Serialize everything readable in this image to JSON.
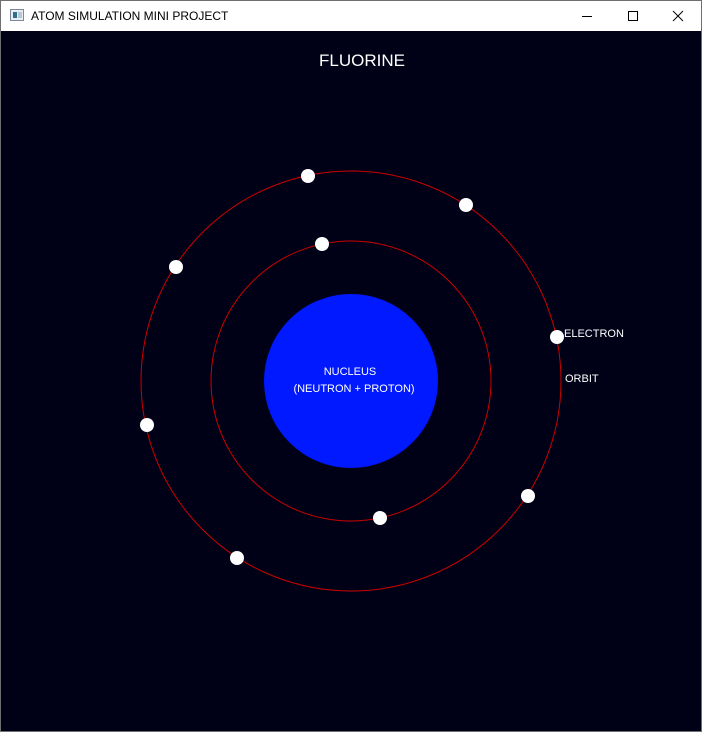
{
  "window": {
    "title": "ATOM SIMULATION MINI PROJECT",
    "icon": "app-window-icon",
    "controls": [
      "minimize-icon",
      "maximize-icon",
      "close-icon"
    ]
  },
  "scene": {
    "element_name": "FLUORINE",
    "nucleus_label": "NUCLEUS",
    "nucleus_sublabel": "(NEUTRON + PROTON)",
    "electron_label": "ELECTRON",
    "orbit_label": "ORBIT",
    "inner_shell_electrons": 2,
    "outer_shell_electrons": 7
  },
  "colors": {
    "background": "#000117",
    "nucleus": "#0019ff",
    "orbit": "#cc0000",
    "electron": "#ffffff",
    "text": "#ffffff"
  }
}
